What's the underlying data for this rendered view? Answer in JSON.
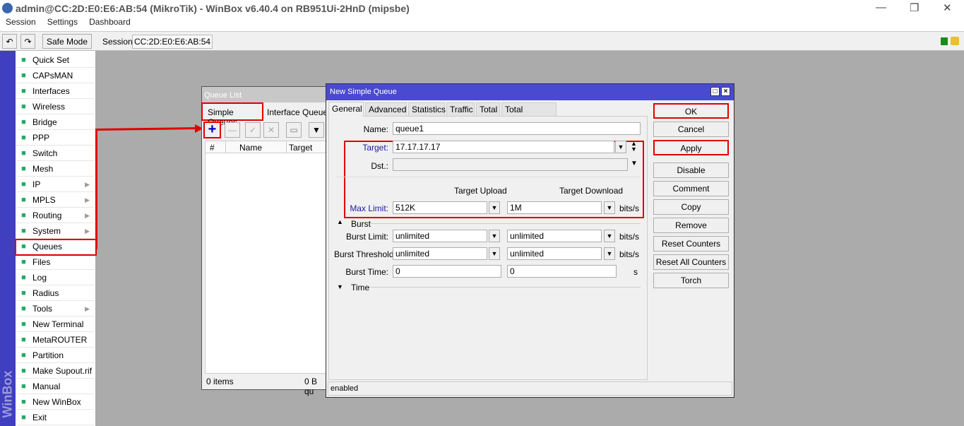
{
  "window": {
    "title": "admin@CC:2D:E0:E6:AB:54 (MikroTik) - WinBox v6.40.4 on RB951Ui-2HnD (mipsbe)",
    "minimize": "—",
    "restore": "❐",
    "close": "✕"
  },
  "menu": [
    "Session",
    "Settings",
    "Dashboard"
  ],
  "toolbar": {
    "undo": "↶",
    "redo": "↷",
    "safe_mode": "Safe Mode",
    "session_label": "Session:",
    "session_value": "CC:2D:E0:E6:AB:54"
  },
  "sidebar": {
    "brand": "WinBox",
    "items": [
      {
        "label": "Quick Set",
        "icon": "wand-icon",
        "sub": false
      },
      {
        "label": "CAPsMAN",
        "icon": "antenna-icon",
        "sub": false
      },
      {
        "label": "Interfaces",
        "icon": "network-card-icon",
        "sub": false
      },
      {
        "label": "Wireless",
        "icon": "antenna-icon",
        "sub": false
      },
      {
        "label": "Bridge",
        "icon": "bridge-icon",
        "sub": false
      },
      {
        "label": "PPP",
        "icon": "ppp-icon",
        "sub": false
      },
      {
        "label": "Switch",
        "icon": "switch-icon",
        "sub": false
      },
      {
        "label": "Mesh",
        "icon": "mesh-icon",
        "sub": false
      },
      {
        "label": "IP",
        "icon": "ip-icon",
        "sub": true
      },
      {
        "label": "MPLS",
        "icon": "mpls-icon",
        "sub": true
      },
      {
        "label": "Routing",
        "icon": "routing-icon",
        "sub": true
      },
      {
        "label": "System",
        "icon": "system-icon",
        "sub": true
      },
      {
        "label": "Queues",
        "icon": "queues-icon",
        "sub": false
      },
      {
        "label": "Files",
        "icon": "folder-icon",
        "sub": false
      },
      {
        "label": "Log",
        "icon": "log-icon",
        "sub": false
      },
      {
        "label": "Radius",
        "icon": "radius-icon",
        "sub": false
      },
      {
        "label": "Tools",
        "icon": "tools-icon",
        "sub": true
      },
      {
        "label": "New Terminal",
        "icon": "terminal-icon",
        "sub": false
      },
      {
        "label": "MetaROUTER",
        "icon": "metarouter-icon",
        "sub": false
      },
      {
        "label": "Partition",
        "icon": "partition-icon",
        "sub": false
      },
      {
        "label": "Make Supout.rif",
        "icon": "supout-icon",
        "sub": false
      },
      {
        "label": "Manual",
        "icon": "manual-icon",
        "sub": false
      },
      {
        "label": "New WinBox",
        "icon": "winbox-icon",
        "sub": false
      },
      {
        "label": "Exit",
        "icon": "exit-icon",
        "sub": false
      }
    ]
  },
  "queue_list": {
    "title": "Queue List",
    "tabs": [
      "Simple Queues",
      "Interface Queues"
    ],
    "columns": [
      "#",
      "",
      "Name",
      "Target"
    ],
    "status_items": "0 items",
    "status_bytes": "0 B qu"
  },
  "dialog": {
    "title": "New Simple Queue",
    "tabs": [
      "General",
      "Advanced",
      "Statistics",
      "Traffic",
      "Total",
      "Total Statistics"
    ],
    "name_label": "Name:",
    "name_value": "queue1",
    "target_label": "Target:",
    "target_value": "17.17.17.17",
    "dst_label": "Dst.:",
    "dst_value": "",
    "upload_header": "Target Upload",
    "download_header": "Target Download",
    "max_limit_label": "Max Limit:",
    "max_upload": "512K",
    "max_download": "1M",
    "unit": "bits/s",
    "burst_section": "Burst",
    "burst_limit_label": "Burst Limit:",
    "burst_limit_up": "unlimited",
    "burst_limit_down": "unlimited",
    "burst_threshold_label": "Burst Threshold:",
    "burst_threshold_up": "unlimited",
    "burst_threshold_down": "unlimited",
    "burst_time_label": "Burst Time:",
    "burst_time_up": "0",
    "burst_time_down": "0",
    "seconds_unit": "s",
    "time_section": "Time",
    "status": "enabled",
    "buttons": [
      "OK",
      "Cancel",
      "Apply",
      "Disable",
      "Comment",
      "Copy",
      "Remove",
      "Reset Counters",
      "Reset All Counters",
      "Torch"
    ]
  },
  "colors": {
    "accent": "#3f3fbf",
    "highlight": "#e00000",
    "link_label": "#1a1aa6"
  }
}
